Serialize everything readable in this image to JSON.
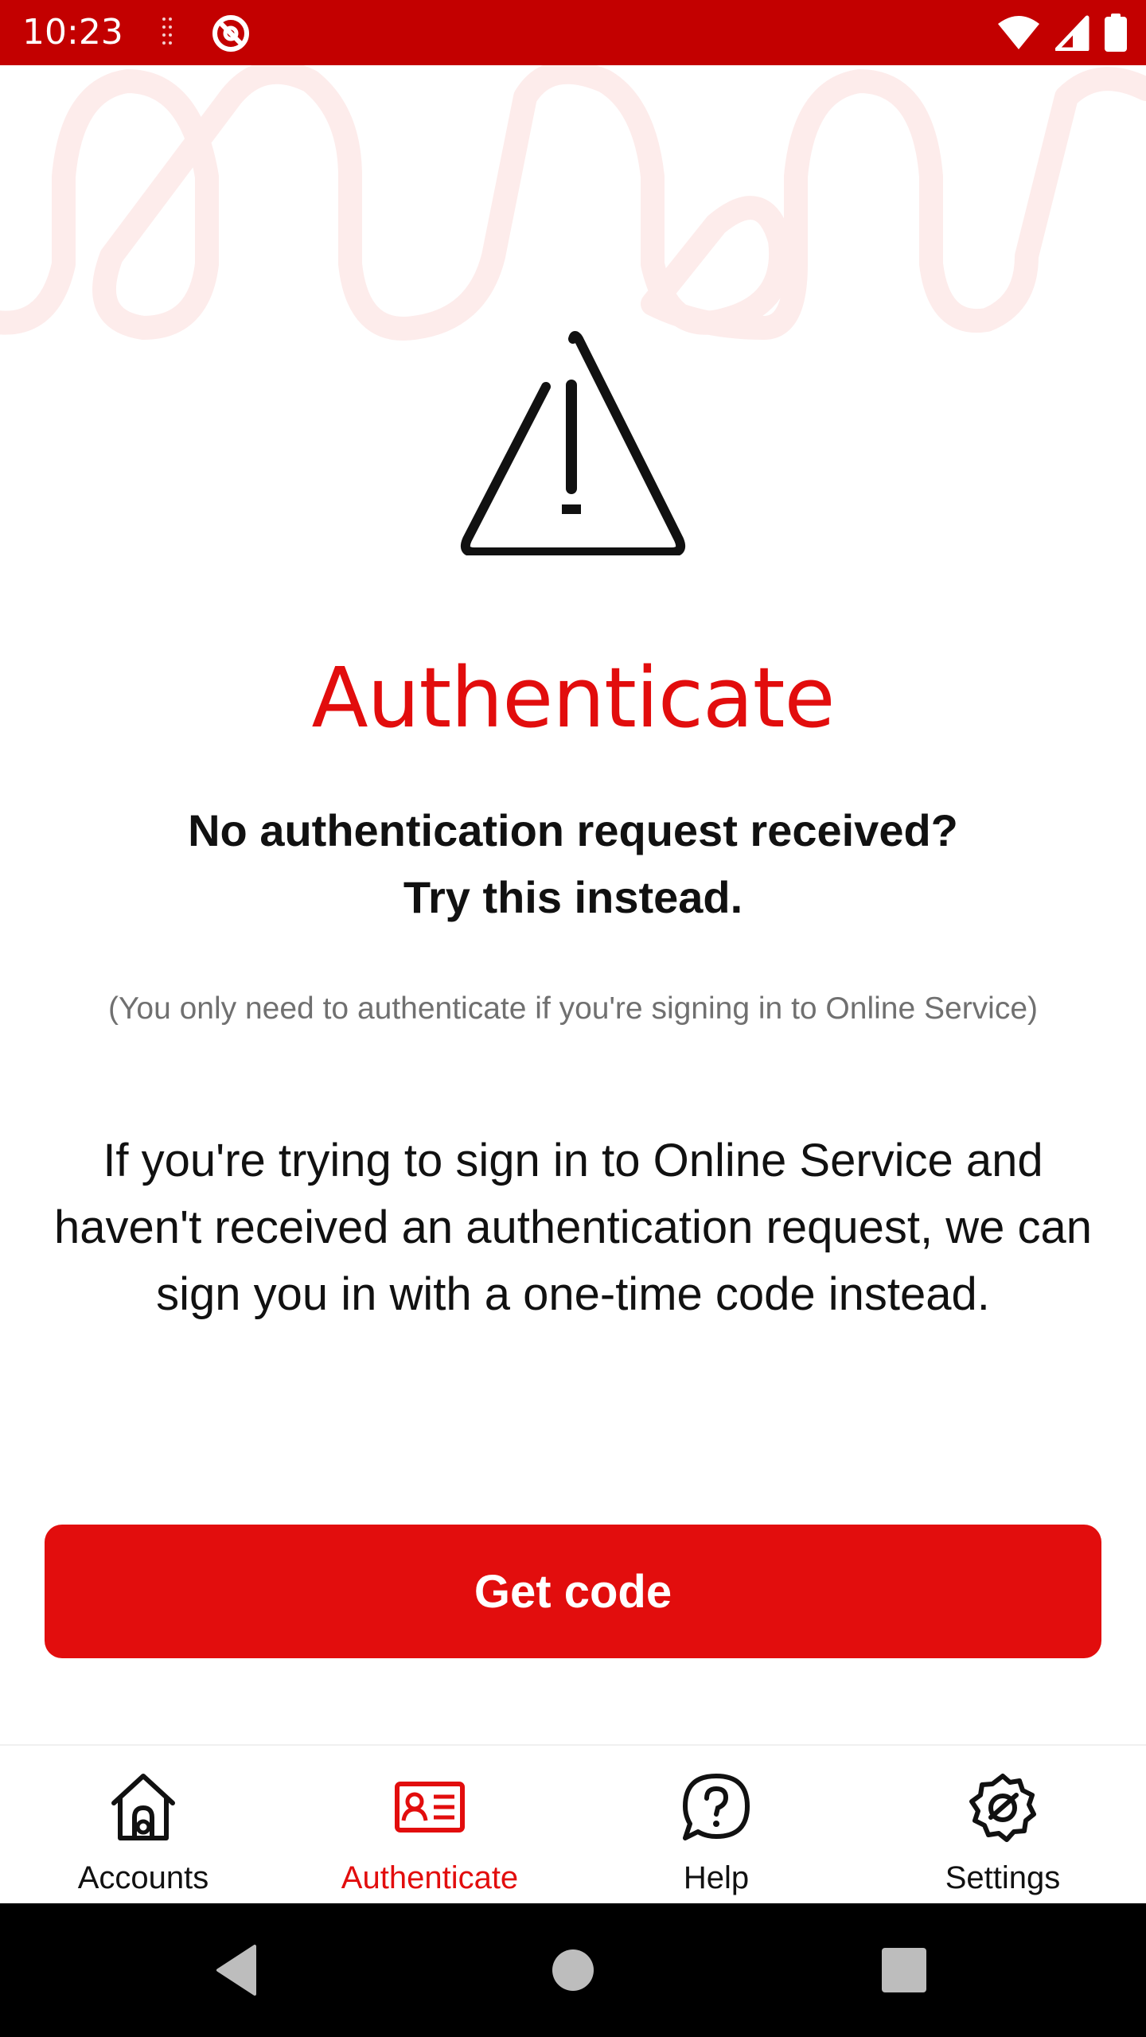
{
  "status_bar": {
    "time": "10:23",
    "icons": [
      "signal-dots-icon",
      "app-status-icon",
      "wifi-icon",
      "cell-signal-icon",
      "battery-icon"
    ]
  },
  "colors": {
    "brand_red": "#e20d0d",
    "status_bar": "#c30000",
    "text": "#111111",
    "muted_text": "#707070"
  },
  "main": {
    "icon": "warning-triangle-icon",
    "title": "Authenticate",
    "subtitle_line1": "No authentication request received?",
    "subtitle_line2": "Try this instead.",
    "note": "(You only need to authenticate if you're signing in to Online Service)",
    "body": "If you're trying to sign in to Online Service and haven't received an authentication request, we can sign you in with a one-time code instead.",
    "button_label": "Get code"
  },
  "bottom_nav": {
    "items": [
      {
        "label": "Accounts",
        "icon": "home-icon",
        "active": false
      },
      {
        "label": "Authenticate",
        "icon": "id-card-icon",
        "active": true
      },
      {
        "label": "Help",
        "icon": "help-bubble-icon",
        "active": false
      },
      {
        "label": "Settings",
        "icon": "settings-gear-icon",
        "active": false
      }
    ]
  },
  "system_nav": {
    "buttons": [
      "back-icon",
      "home-circle-icon",
      "recents-icon"
    ]
  }
}
